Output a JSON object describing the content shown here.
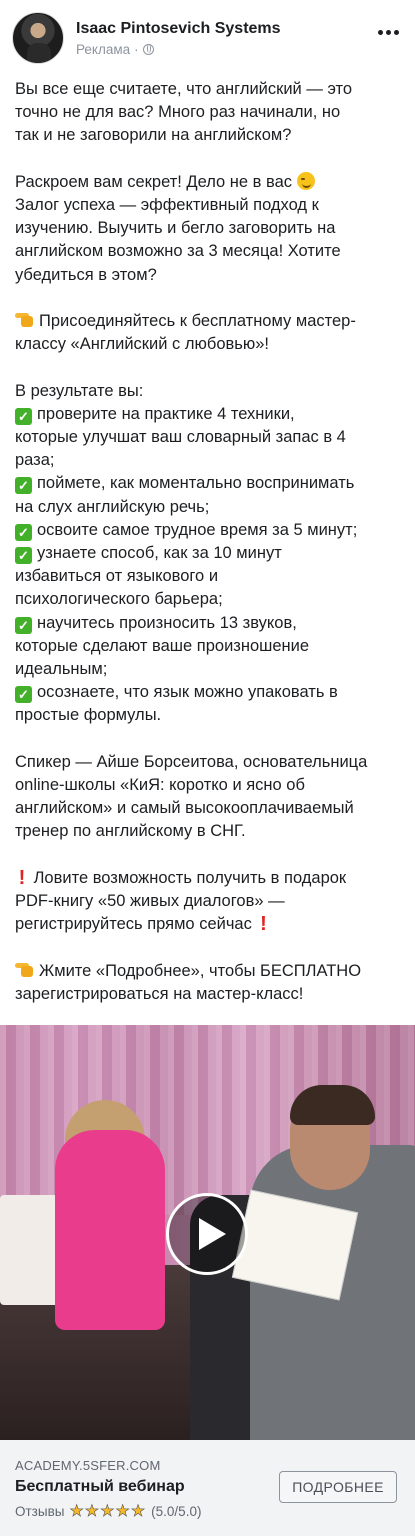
{
  "post": {
    "page_name": "Isaac Pintosevich Systems",
    "sponsored": "Реклама",
    "sponsored_separator": "·",
    "privacy_icon": "globe-icon",
    "menu_icon": "more-dots-icon"
  },
  "body": {
    "p1": [
      "Вы все еще считаете, что английский — это",
      "точно не для вас? Много раз начинали, но",
      "так и не заговорили на английском?"
    ],
    "p2_first": "Раскроем вам секрет! Дело не в вас",
    "p2_rest": [
      "Залог успеха — эффективный подход к",
      "изучению. Выучить и бегло заговорить на",
      "английском возможно за 3 месяца! Хотите",
      "убедиться в этом?"
    ],
    "p3": [
      "Присоединяйтесь к бесплатному мастер-",
      "классу «Английский с любовью»!"
    ],
    "p4_intro": "В результате вы:",
    "bullets": [
      {
        "first": "проверите на практике 4 техники,",
        "rest": [
          "которые улучшат ваш словарный запас в 4",
          "раза;"
        ]
      },
      {
        "first": "поймете, как моментально воспринимать",
        "rest": [
          "на слух английскую речь;"
        ]
      },
      {
        "first": "освоите самое трудное время за 5 минут;",
        "rest": []
      },
      {
        "first": "узнаете способ, как за 10 минут",
        "rest": [
          "избавиться от языкового и",
          "психологического барьера;"
        ]
      },
      {
        "first": "научитесь произносить 13 звуков,",
        "rest": [
          "которые сделают ваше произношение",
          "идеальным;"
        ]
      },
      {
        "first": "осознаете, что язык можно упаковать в",
        "rest": [
          "простые формулы."
        ]
      }
    ],
    "p5": [
      "Спикер — Айше Борсеитова, основательница",
      "online-школы «КиЯ: коротко и ясно об",
      "английском» и самый высокооплачиваемый",
      "тренер по английскому в СНГ."
    ],
    "p6": [
      "Ловите возможность получить в подарок",
      "PDF-книгу «50 живых диалогов» —",
      "регистрируйтесь прямо сейчас"
    ],
    "p7": [
      "Жмите «Подробнее», чтобы БЕСПЛАТНО",
      "зарегистрироваться на мастер-класс!"
    ],
    "emoji": {
      "wink": "winking-face-icon",
      "pointing": "pointing-hand-icon",
      "check": "check-mark-icon",
      "exclamation": "exclamation-mark-icon"
    }
  },
  "media": {
    "type": "video",
    "play_icon": "play-icon"
  },
  "cta": {
    "domain": "ACADEMY.5SFER.COM",
    "title": "Бесплатный вебинар",
    "reviews_label": "Отзывы",
    "rating_text": "(5.0/5.0)",
    "rating_value": 5,
    "rating_max": 5,
    "button_label": "ПОДРОБНЕЕ"
  },
  "colors": {
    "text": "#1c1e21",
    "secondary": "#8d949e",
    "check_green": "#43b02a",
    "exclamation_red": "#e02424",
    "star_gold": "#f7b928",
    "cta_background": "#f2f3f5"
  }
}
